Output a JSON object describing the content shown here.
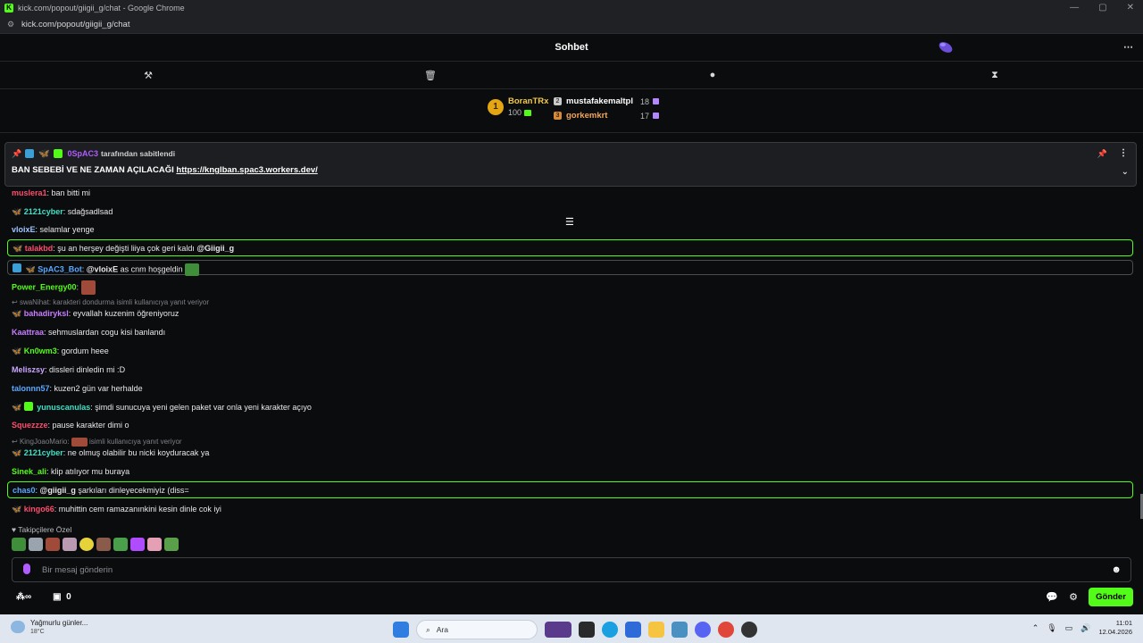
{
  "window": {
    "title": "kick.com/popout/giigii_g/chat - Google Chrome",
    "url": "kick.com/popout/giigii_g/chat"
  },
  "chat": {
    "title": "Sohbet"
  },
  "leaderboard": {
    "first": {
      "rank": "1",
      "name": "BoranTRx",
      "points": "100"
    },
    "others": [
      {
        "name": "mustafakemaltpl",
        "points": "18"
      },
      {
        "name": "gorkemkrt",
        "points": "17"
      }
    ]
  },
  "pinned": {
    "user": "0SpAC3",
    "by_text": "tarafından sabitlendi",
    "message": "BAN SEBEBİ VE NE ZAMAN AÇILACAĞI",
    "link": "https://knglban.spac3.workers.dev/"
  },
  "messages": [
    {
      "user": "muslera1",
      "color": "#ff4d6d",
      "text": ": ban bitti mi"
    },
    {
      "user": "2121cyber",
      "color": "#3fe0c5",
      "text": ": sdağsadlsad"
    },
    {
      "user": "vloixE",
      "color": "#9ec5ff",
      "text": ": selamlar yenge"
    },
    {
      "user": "talakbd",
      "color": "#ff4d6d",
      "text": ": şu an herşey değişti liiya çok geri kaldı ",
      "mention": "@Giigii_g"
    },
    {
      "user": "SpAC3_Bot",
      "color": "#5aa9ff",
      "text": " as cnm hoşgeldin",
      "mention": "@vloixE"
    },
    {
      "user": "Power_Energy00",
      "color": "#53fc18",
      "text": ":"
    },
    {
      "reply_user": "swaNihat",
      "reply_text": ": karakteri dondurma isimli kullanıcıya yanıt veriyor"
    },
    {
      "user": "bahadiryksl",
      "color": "#c77dff",
      "text": ": eyvallah kuzenim öğreniyoruz"
    },
    {
      "user": "Kaattraa",
      "color": "#c77dff",
      "text": ": sehmuslardan cogu kisi banlandı"
    },
    {
      "user": "Kn0wm3",
      "color": "#53fc18",
      "text": ": gordum heee"
    },
    {
      "user": "Meliszsy",
      "color": "#c9a7ff",
      "text": ": dissleri dinledin mi :D"
    },
    {
      "user": "talonnn57",
      "color": "#5aa9ff",
      "text": ": kuzen2 gün var herhalde"
    },
    {
      "user": "yunuscanulas",
      "color": "#3fe0c5",
      "text": ": şimdi sunucuya yeni gelen paket var onla yeni karakter açıyo"
    },
    {
      "user": "Squezzze",
      "color": "#ff4d6d",
      "text": ": pause karakter dimi o"
    },
    {
      "reply_user": "KingJoaoMario",
      "reply_text": "isimli kullanıcıya yanıt veriyor"
    },
    {
      "user": "2121cyber",
      "color": "#3fe0c5",
      "text": ": ne olmuş olabilir bu nicki koyduracak ya"
    },
    {
      "user": "Sinek_ali",
      "color": "#53fc18",
      "text": ": klip atılıyor mu buraya"
    },
    {
      "user": "chas0",
      "color": "#5aa9ff",
      "text": " şarkıları dinleyecekmiyiz (diss=",
      "mention": "@giigii_g"
    },
    {
      "user": "kingo66",
      "color": "#ff4d6d",
      "text": ": muhittin cem ramazanınkini kesin dinle cok iyi"
    }
  ],
  "emote_tray": {
    "label": "Takipçilere Özel"
  },
  "input": {
    "placeholder": "Bir mesaj gönderin"
  },
  "footer": {
    "points": "0",
    "send_label": "Gönder"
  },
  "taskbar": {
    "weather_title": "Yağmurlu günler...",
    "weather_temp": "18°C",
    "search": "Ara",
    "time": "11:01",
    "date": "12.04.2026"
  },
  "colors": {
    "accent": "#53fc18",
    "background": "#0b0c0e",
    "pinned_bg": "#1c1e21"
  }
}
